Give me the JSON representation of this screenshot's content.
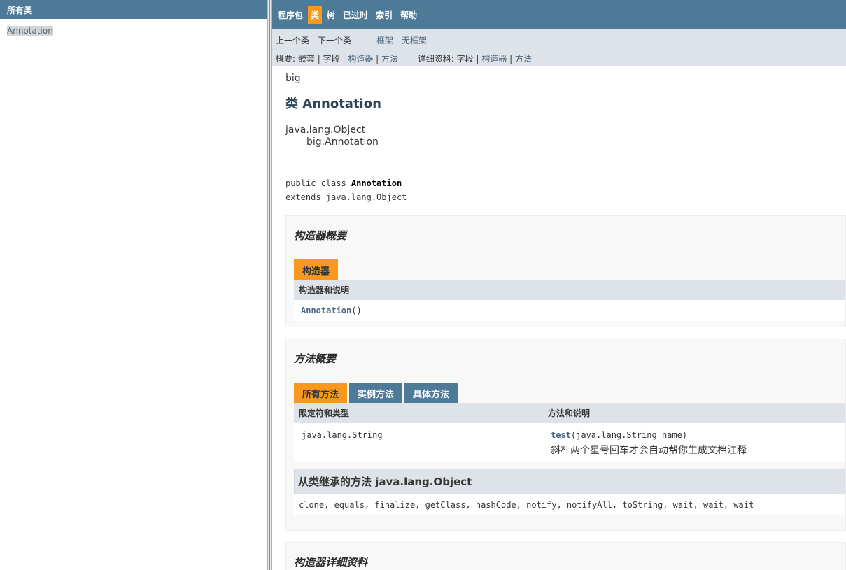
{
  "left": {
    "header": "所有类",
    "classes": [
      "Annotation"
    ]
  },
  "topnav": {
    "items": [
      "程序包",
      "类",
      "树",
      "已过时",
      "索引",
      "帮助"
    ]
  },
  "subnav": {
    "prev_class": "上一个类",
    "next_class": "下一个类",
    "frames": "框架",
    "no_frames": "无框架",
    "summary_label": "概要:",
    "summary_nested": "嵌套",
    "summary_field": "字段",
    "summary_constr": "构造器",
    "summary_method": "方法",
    "detail_label": "详细资料:",
    "detail_field": "字段",
    "detail_constr": "构造器",
    "detail_method": "方法",
    "pipe": "|"
  },
  "content": {
    "package": "big",
    "title": "类 Annotation",
    "inherit_root": "java.lang.Object",
    "inherit_child": "big.Annotation",
    "decl_prefix": "public class ",
    "decl_name": "Annotation",
    "decl_extends": "extends java.lang.Object"
  },
  "constructor_summary": {
    "heading": "构造器概要",
    "tab": "构造器",
    "col_header": "构造器和说明",
    "name": "Annotation",
    "parens": "()"
  },
  "method_summary": {
    "heading": "方法概要",
    "tabs": [
      "所有方法",
      "实例方法",
      "具体方法"
    ],
    "col1": "限定符和类型",
    "col2": "方法和说明",
    "row_type": "java.lang.String",
    "row_method": "test",
    "row_params": "(java.lang.String  name)",
    "row_desc": "斜杠两个星号回车才会自动帮你生成文档注释",
    "inherited_heading": "从类继承的方法 java.lang.Object",
    "inherited_list": "clone, equals, finalize, getClass, hashCode, notify, notifyAll, toString, wait, wait, wait"
  },
  "constructor_detail": {
    "heading": "构造器详细资料"
  }
}
